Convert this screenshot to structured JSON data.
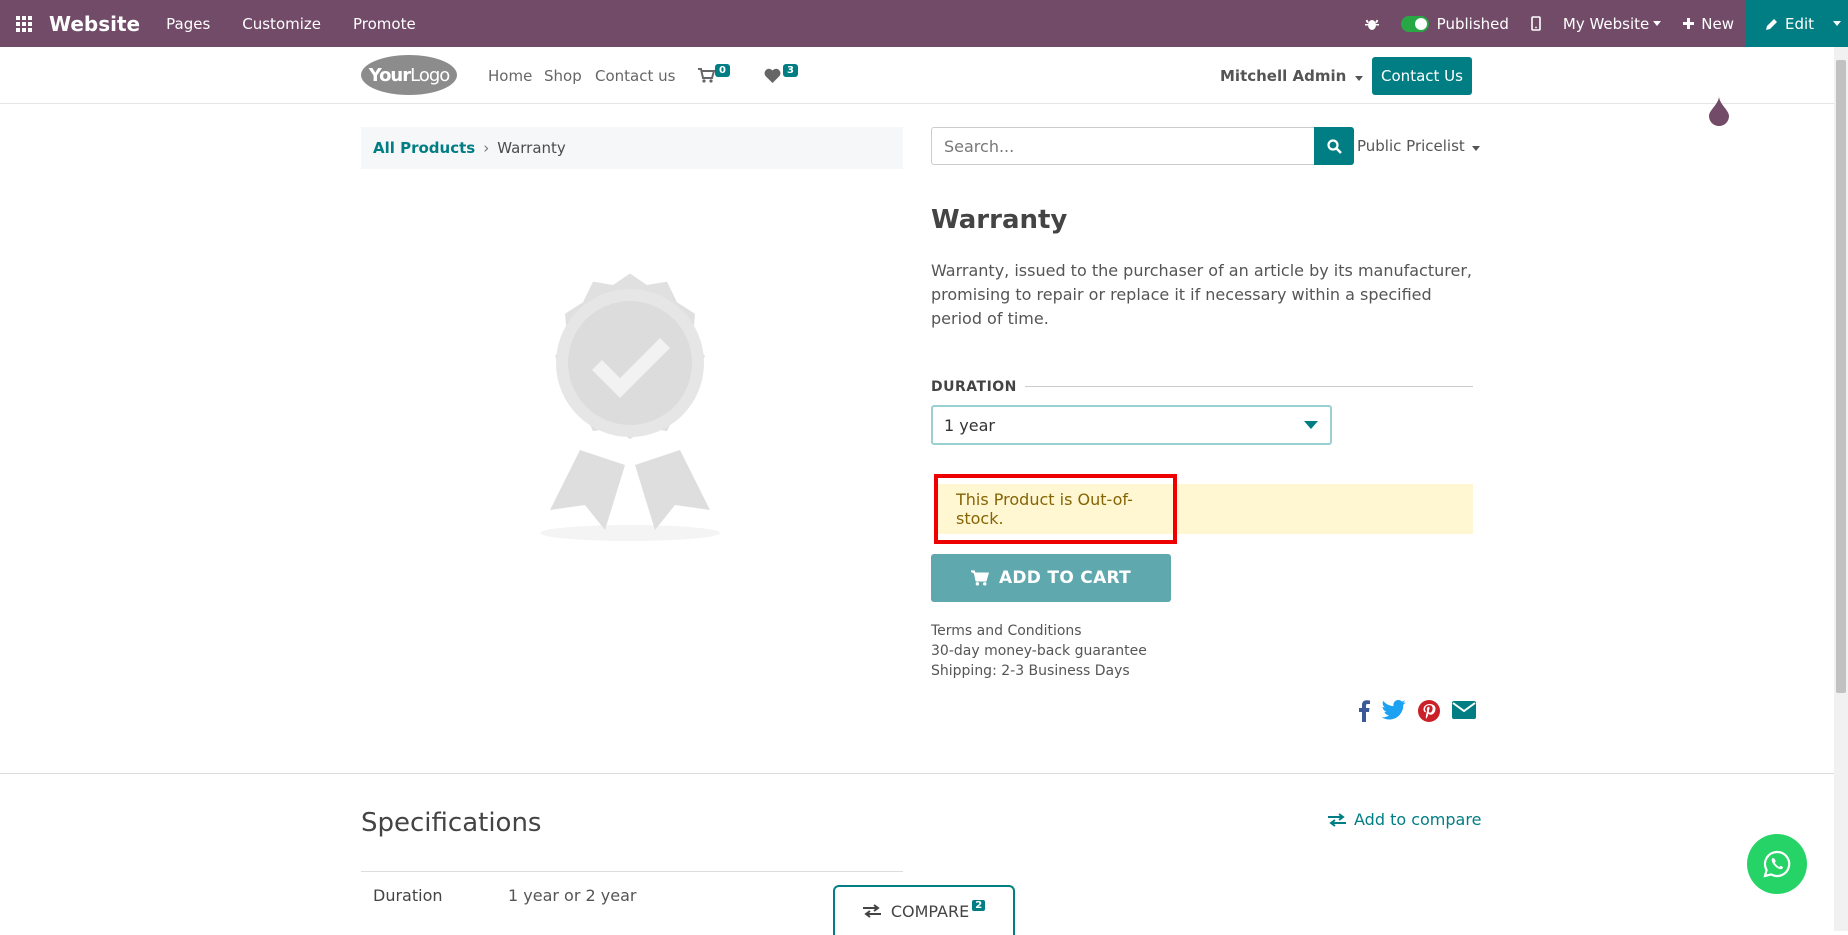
{
  "admin": {
    "brand": "Website",
    "menu": [
      "Pages",
      "Customize",
      "Promote"
    ],
    "published": "Published",
    "website": "My Website",
    "new_label": "New",
    "edit_label": "Edit"
  },
  "header": {
    "logo_bold": "Your",
    "logo_thin": "Logo",
    "nav": [
      "Home",
      "Shop",
      "Contact us"
    ],
    "cart_count": "0",
    "wishlist_count": "3",
    "user": "Mitchell Admin",
    "contact_button": "Contact Us"
  },
  "breadcrumb": {
    "root": "All Products",
    "sep": "›",
    "current": "Warranty"
  },
  "search": {
    "placeholder": "Search...",
    "pricelist": "Public Pricelist"
  },
  "product": {
    "title": "Warranty",
    "description": "Warranty, issued to the purchaser of an article by its manufacturer, promising to repair or replace it if necessary within a specified period of time.",
    "attribute_label": "DURATION",
    "attribute_value": "1 year",
    "stock_message": "This Product is Out-of-stock.",
    "add_to_cart": "ADD TO CART",
    "terms": [
      "Terms and Conditions",
      "30-day money-back guarantee",
      "Shipping: 2-3 Business Days"
    ]
  },
  "specs": {
    "title": "Specifications",
    "add_compare": "Add to compare",
    "rows": [
      {
        "name": "Duration",
        "value": "1 year or 2 year"
      }
    ]
  },
  "compare": {
    "label": "COMPARE",
    "count": "2"
  },
  "colors": {
    "admin": "#714b67",
    "primary": "#017e84",
    "alert_bg": "#fff6d2",
    "alert_border": "#ee0000",
    "whatsapp": "#25d366"
  }
}
